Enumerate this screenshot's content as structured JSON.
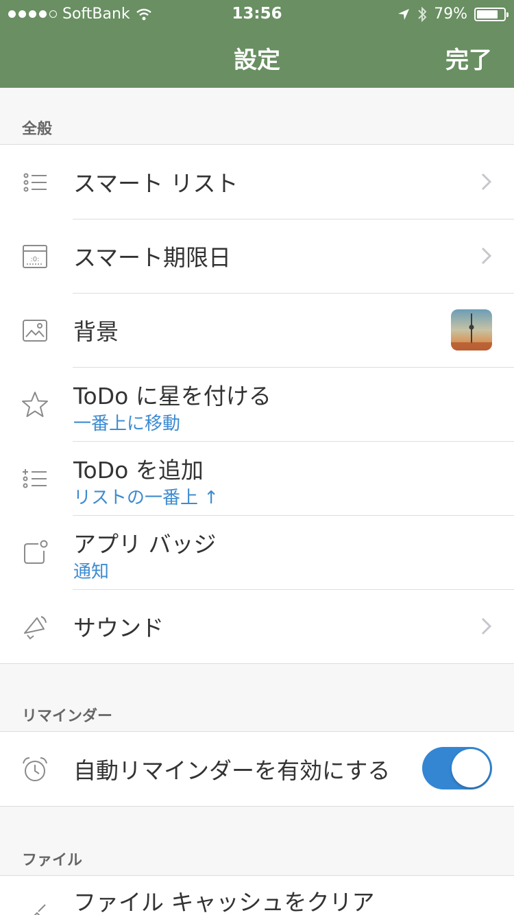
{
  "status_bar": {
    "carrier": "SoftBank",
    "time": "13:56",
    "battery": "79%",
    "battery_level": 0.79,
    "signal_bars_filled": 4,
    "signal_bars_total": 5
  },
  "nav": {
    "title": "設定",
    "done_label": "完了"
  },
  "sections": {
    "general": {
      "header": "全般",
      "rows": {
        "smart_list": {
          "title": "スマート リスト",
          "icon": "list-icon"
        },
        "smart_due": {
          "title": "スマート期限日",
          "icon": "calendar-icon"
        },
        "background": {
          "title": "背景",
          "icon": "image-icon"
        },
        "star_todo": {
          "title": "ToDo に星を付ける",
          "subtitle": "一番上に移動",
          "icon": "star-icon"
        },
        "add_todo": {
          "title": "ToDo を追加",
          "subtitle": "リストの一番上 ↑",
          "icon": "add-list-icon"
        },
        "app_badge": {
          "title": "アプリ バッジ",
          "subtitle": "通知",
          "icon": "badge-icon"
        },
        "sound": {
          "title": "サウンド",
          "icon": "megaphone-icon"
        }
      }
    },
    "reminders": {
      "header": "リマインダー",
      "rows": {
        "auto_reminder": {
          "title": "自動リマインダーを有効にする",
          "icon": "alarm-clock-icon",
          "enabled": true
        }
      }
    },
    "files": {
      "header": "ファイル",
      "rows": {
        "clear_cache": {
          "title": "ファイル キャッシュをクリア",
          "icon": "broom-icon"
        }
      }
    }
  },
  "colors": {
    "nav_background": "#698f62",
    "accent_blue": "#3d8bd0",
    "toggle_on": "#3486d3"
  }
}
